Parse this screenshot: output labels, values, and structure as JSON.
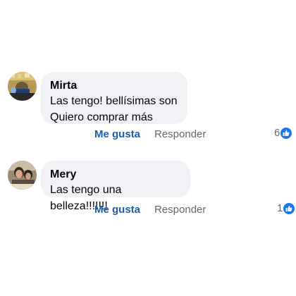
{
  "comments": [
    {
      "author": "Mirta",
      "lines": [
        "Las tengo! bellísimas son",
        "Quiero comprar más"
      ],
      "like_label": "Me gusta",
      "reply_label": "Responder",
      "reaction_count": "6",
      "reaction_icon": "like-icon"
    },
    {
      "author": "Mery",
      "lines": [
        "Las tengo una belleza!!!!!!!"
      ],
      "like_label": "Me gusta",
      "reply_label": "Responder",
      "reaction_count": "1",
      "reaction_icon": "like-icon"
    }
  ],
  "colors": {
    "bubble": "#f0f2f5",
    "link": "#1d5ea8",
    "muted": "#65676b",
    "like_badge": "#1877f2"
  }
}
